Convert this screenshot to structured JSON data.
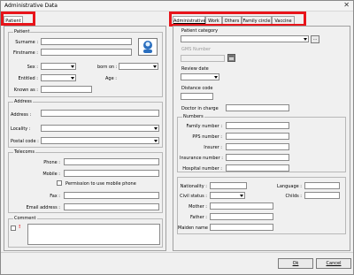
{
  "window": {
    "title": "Administrative Data"
  },
  "left_tab": "Patient",
  "right_tabs": [
    "Administrative",
    "Work",
    "Others",
    "Family circle",
    "Vaccine"
  ],
  "patient": {
    "group": "Patient",
    "surname": "Surname :",
    "firstname": "Firstname :",
    "sex": "Sex :",
    "born_on": "born on :",
    "entitled": "Entitled :",
    "age": "Age :",
    "known_as": "Known as :"
  },
  "address": {
    "group": "Address",
    "address": "Address :",
    "locality": "Locality :",
    "postal_code": "Postal code :"
  },
  "telecoms": {
    "group": "Telecoms",
    "phone": "Phone :",
    "mobile": "Mobile :",
    "permission": "Permission to use mobile phone",
    "fax": "Fax :",
    "email": "Email address :"
  },
  "comment": {
    "group": "Comment",
    "mark": "!"
  },
  "admin": {
    "patient_category": "Patient category",
    "browse": "...",
    "gms_number": "GMS Number",
    "review_date": "Review date",
    "distance_code": "Distance code",
    "doctor_in_charge": "Doctor in charge",
    "numbers_group": "Numbers",
    "family_number": "Family number :",
    "pps_number": "PPS number :",
    "insurer": "Insurer :",
    "insurance_number": "Insurance number :",
    "hospital_number": "Hospital number :",
    "nationality": "Nationality :",
    "language": "Language :",
    "civil_status": "Civil status :",
    "childs": "Childs :",
    "mother": "Mother :",
    "father": "Father :",
    "maiden_name": "Maiden name :"
  },
  "footer": {
    "ok": "Ok",
    "cancel": "Cancel"
  },
  "icons": {
    "photo": "person-photo-icon",
    "calendar": "calendar-icon",
    "close": "close-icon"
  },
  "colors": {
    "highlight": "#e8141a",
    "window_bg": "#f0f0f0"
  }
}
